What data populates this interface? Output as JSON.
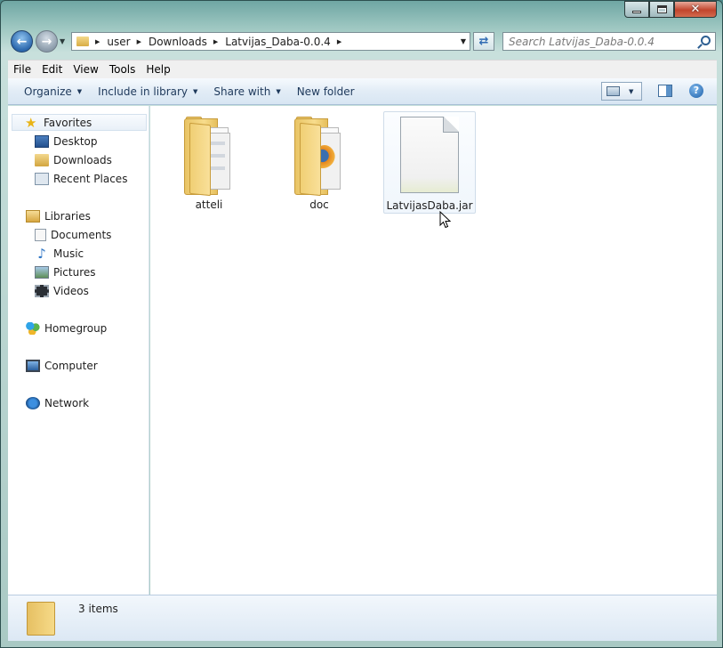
{
  "address": {
    "crumbs": [
      "user",
      "Downloads",
      "Latvijas_Daba-0.0.4"
    ]
  },
  "search": {
    "placeholder": "Search Latvijas_Daba-0.0.4"
  },
  "menu": [
    "File",
    "Edit",
    "View",
    "Tools",
    "Help"
  ],
  "toolbar": {
    "organize": "Organize",
    "include_in_library": "Include in library",
    "share_with": "Share with",
    "new_folder": "New folder"
  },
  "nav": {
    "favorites": "Favorites",
    "desktop": "Desktop",
    "downloads": "Downloads",
    "recent_places": "Recent Places",
    "libraries": "Libraries",
    "documents": "Documents",
    "music": "Music",
    "pictures": "Pictures",
    "videos": "Videos",
    "homegroup": "Homegroup",
    "computer": "Computer",
    "network": "Network"
  },
  "files": [
    {
      "name": "atteli",
      "type": "folder"
    },
    {
      "name": "doc",
      "type": "folder"
    },
    {
      "name": "LatvijasDaba.jar",
      "type": "file"
    }
  ],
  "status": {
    "count": "3 items"
  }
}
